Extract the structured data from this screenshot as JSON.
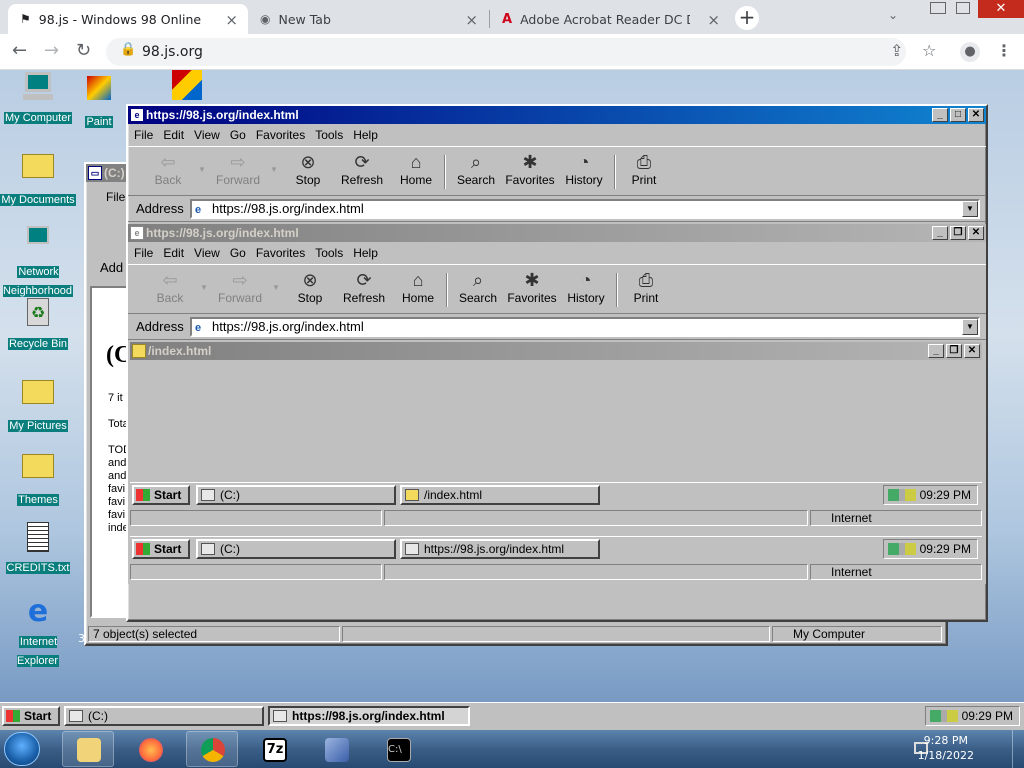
{
  "chrome": {
    "tabs": [
      {
        "title": "98.js - Windows 98 Online"
      },
      {
        "title": "New Tab"
      },
      {
        "title": "Adobe Acrobat Reader DC Down"
      }
    ],
    "url": "98.js.org"
  },
  "desktop": {
    "icons": [
      {
        "label": "My Computer"
      },
      {
        "label": "Paint"
      },
      {
        "label": "My Documents"
      },
      {
        "label": "Network Neighborhood"
      },
      {
        "label": "Recycle Bin"
      },
      {
        "label": "My Pictures"
      },
      {
        "label": "Themes"
      },
      {
        "label": "CREDITS.txt"
      },
      {
        "label": "Internet Explorer"
      }
    ]
  },
  "explorer_back": {
    "title": "(C:)",
    "file_label": "File",
    "addr_label": "Add",
    "heading": "(C",
    "lines": [
      "7 it",
      "Tota",
      "TOD",
      "and",
      "and",
      "favi",
      "favi",
      "favi",
      "inde"
    ],
    "status_left": "7 object(s) selected",
    "status_right": "My Computer",
    "number": "3"
  },
  "ie_outer": {
    "title": "https://98.js.org/index.html",
    "menu": [
      "File",
      "Edit",
      "View",
      "Go",
      "Favorites",
      "Tools",
      "Help"
    ],
    "toolbar": [
      "Back",
      "Forward",
      "Stop",
      "Refresh",
      "Home",
      "Search",
      "Favorites",
      "History",
      "Print"
    ],
    "address_label": "Address",
    "address": "https://98.js.org/index.html",
    "status_zone": "Internet"
  },
  "ie_inner": {
    "title": "https://98.js.org/index.html",
    "menu": [
      "File",
      "Edit",
      "View",
      "Go",
      "Favorites",
      "Tools",
      "Help"
    ],
    "toolbar": [
      "Back",
      "Forward",
      "Stop",
      "Refresh",
      "Home",
      "Search",
      "Favorites",
      "History",
      "Print"
    ],
    "address_label": "Address",
    "address": "https://98.js.org/index.html",
    "status_zone": "Internet"
  },
  "folder_win": {
    "title": "/index.html"
  },
  "inner_taskbar1": {
    "start": "Start",
    "btn1": "(C:)",
    "btn2": "/index.html",
    "time": "09:29 PM"
  },
  "inner_taskbar2": {
    "start": "Start",
    "btn1": "(C:)",
    "btn2": "https://98.js.org/index.html",
    "time": "09:29 PM"
  },
  "main_taskbar": {
    "start": "Start",
    "btn1": "(C:)",
    "btn2": "https://98.js.org/index.html",
    "time": "09:29 PM"
  },
  "win7": {
    "time": "9:28 PM",
    "date": "1/18/2022"
  }
}
